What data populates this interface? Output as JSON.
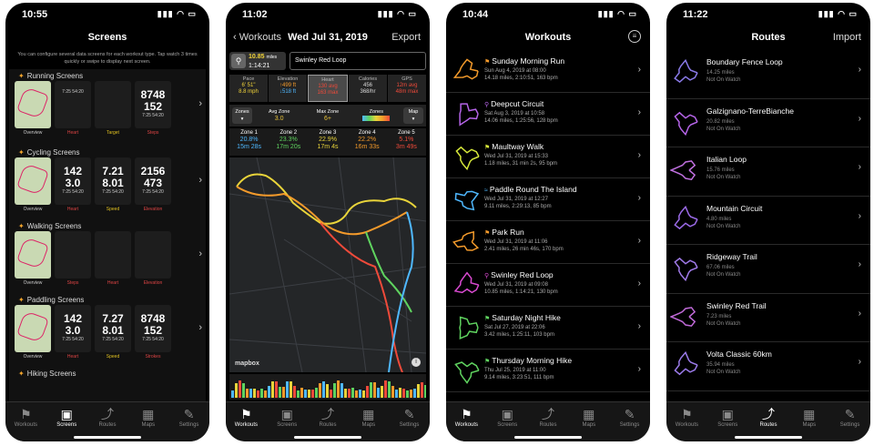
{
  "tabs": [
    {
      "label": "Workouts",
      "icon": "runner-icon"
    },
    {
      "label": "Screens",
      "icon": "screens-icon"
    },
    {
      "label": "Routes",
      "icon": "routes-icon"
    },
    {
      "label": "Maps",
      "icon": "maps-icon"
    },
    {
      "label": "Settings",
      "icon": "wrench-icon"
    }
  ],
  "phone1": {
    "time": "10:55",
    "title": "Screens",
    "description": "You can configure several data screens for each workout type. Tap watch 3 times quickly or swipe to display next screen.",
    "sections": [
      {
        "title": "Running Screens",
        "labels": [
          "Overview",
          "Heart",
          "Target",
          "Steps"
        ],
        "big": [
          "",
          "",
          "",
          "8748"
        ],
        "big2": [
          "",
          "",
          "",
          "152"
        ],
        "small": [
          "",
          "7:25 54:20",
          "",
          "7:25 54:20"
        ]
      },
      {
        "title": "Cycling Screens",
        "labels": [
          "Overview",
          "Heart",
          "Speed",
          "Elevation"
        ],
        "big": [
          "",
          "142",
          "7.21",
          "2156"
        ],
        "big2": [
          "",
          "3.0",
          "8.01",
          "473"
        ],
        "small": [
          "",
          "7:25 54:20",
          "7:25 54:20",
          "7:25 54:20"
        ]
      },
      {
        "title": "Walking Screens",
        "labels": [
          "Overview",
          "Steps",
          "Heart",
          "Elevation"
        ],
        "big": [
          "",
          "",
          "",
          ""
        ],
        "big2": [
          "",
          "",
          "",
          ""
        ],
        "small": [
          "",
          "",
          "",
          ""
        ]
      },
      {
        "title": "Paddling Screens",
        "labels": [
          "Overview",
          "Heart",
          "Speed",
          "Strokes"
        ],
        "big": [
          "",
          "142",
          "7.27",
          "8748"
        ],
        "big2": [
          "",
          "3.0",
          "8.01",
          "152"
        ],
        "small": [
          "",
          "7:25 54:20",
          "7:25 54:20",
          "7:25 54:20"
        ]
      },
      {
        "title": "Hiking Screens",
        "labels": [],
        "big": [],
        "big2": [],
        "small": []
      }
    ]
  },
  "phone2": {
    "time": "11:02",
    "back": "Workouts",
    "title": "Wed Jul 31, 2019",
    "export": "Export",
    "distance": "10.85",
    "distance_unit": "miles",
    "duration": "1:14:21",
    "route_name": "Swinley Red Loop",
    "stats": [
      {
        "label": "Pace",
        "v1": "6' 51\"",
        "v2": "8.8 mph"
      },
      {
        "label": "Elevation",
        "v1": "↑499 ft",
        "v2": "↓518 ft"
      },
      {
        "label": "Heart",
        "v1": "130 avg",
        "v2": "163 max"
      },
      {
        "label": "Calories",
        "v1": "456",
        "v2": "368/hr"
      },
      {
        "label": "GPS",
        "v1": "12m avg",
        "v2": "48m max"
      }
    ],
    "zones_btn": "Zones",
    "map_btn": "Map",
    "avg_zone_label": "Avg Zone",
    "avg_zone": "3.0",
    "max_zone_label": "Max Zone",
    "max_zone": "6+",
    "zones_label": "Zones",
    "zones": [
      {
        "name": "Zone 1",
        "pct": "20.8%",
        "time": "15m 28s",
        "color": "#4fb8ff"
      },
      {
        "name": "Zone 2",
        "pct": "23.3%",
        "time": "17m 20s",
        "color": "#5fd35f"
      },
      {
        "name": "Zone 3",
        "pct": "22.9%",
        "time": "17m 4s",
        "color": "#e9d43a"
      },
      {
        "name": "Zone 4",
        "pct": "22.2%",
        "time": "16m 33s",
        "color": "#f39a2b"
      },
      {
        "name": "Zone 5",
        "pct": "5.1%",
        "time": "3m 49s",
        "color": "#ef4a3a"
      }
    ],
    "map_logo": "mapbox"
  },
  "phone3": {
    "time": "10:44",
    "title": "Workouts",
    "items": [
      {
        "title": "Sunday Morning Run",
        "line1": "Sun Aug 4, 2019 at 08:00",
        "line2": "14.18 miles, 2:10:51, 163 bpm",
        "icon": "run",
        "color": "#f39a2b"
      },
      {
        "title": "Deepcut Circuit",
        "line1": "Sat Aug 3, 2019 at 10:58",
        "line2": "14.06 miles, 1:25:56, 128 bpm",
        "icon": "bike",
        "color": "#b564e8"
      },
      {
        "title": "Maultway Walk",
        "line1": "Wed Jul 31, 2019 at 15:33",
        "line2": "1.18 miles, 31 min 2s, 95 bpm",
        "icon": "walk",
        "color": "#d6e83a"
      },
      {
        "title": "Paddle Round The Island",
        "line1": "Wed Jul 31, 2019 at 12:27",
        "line2": "9.11 miles, 2:29:13, 85 bpm",
        "icon": "paddle",
        "color": "#4fb8ff"
      },
      {
        "title": "Park Run",
        "line1": "Wed Jul 31, 2019 at 11:06",
        "line2": "2.41 miles, 26 min 46s, 170 bpm",
        "icon": "run",
        "color": "#f39a2b"
      },
      {
        "title": "Swinley Red Loop",
        "line1": "Wed Jul 31, 2019 at 09:08",
        "line2": "10.85 miles, 1:14:21, 130 bpm",
        "icon": "bike",
        "color": "#d94ad0"
      },
      {
        "title": "Saturday Night Hike",
        "line1": "Sat Jul 27, 2019 at 22:06",
        "line2": "3.42 miles, 1:25:11, 103 bpm",
        "icon": "hike",
        "color": "#5fd35f"
      },
      {
        "title": "Thursday Morning Hike",
        "line1": "Thu Jul 25, 2019 at 11:00",
        "line2": "9.14 miles, 3:23:51, 111 bpm",
        "icon": "hike",
        "color": "#5fd35f"
      }
    ]
  },
  "phone4": {
    "time": "11:22",
    "title": "Routes",
    "import": "Import",
    "items": [
      {
        "title": "Boundary Fence Loop",
        "dist": "14.25 miles",
        "status": "Not On Watch",
        "color": "#8a7ae8"
      },
      {
        "title": "Galzignano-TerreBianche",
        "dist": "20.82 miles",
        "status": "Not On Watch",
        "color": "#b564e8"
      },
      {
        "title": "Italian Loop",
        "dist": "15.76 miles",
        "status": "Not On Watch",
        "color": "#c070e0"
      },
      {
        "title": "Mountain Circuit",
        "dist": "4.80 miles",
        "status": "Not On Watch",
        "color": "#9b6ae8"
      },
      {
        "title": "Ridgeway Trail",
        "dist": "67.06 miles",
        "status": "Not On Watch",
        "color": "#a07ae8"
      },
      {
        "title": "Swinley Red Trail",
        "dist": "7.23 miles",
        "status": "Not On Watch",
        "color": "#c06ad8"
      },
      {
        "title": "Volta Classic 60km",
        "dist": "35.94 miles",
        "status": "Not On Watch",
        "color": "#9a7ae8"
      }
    ]
  }
}
